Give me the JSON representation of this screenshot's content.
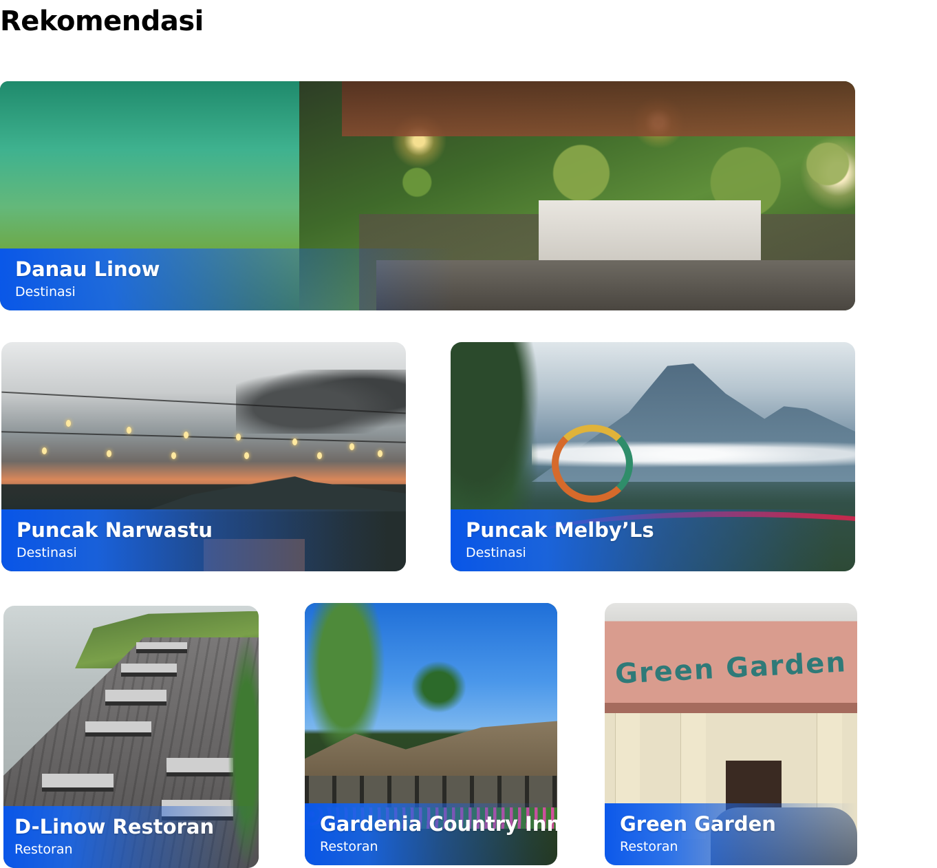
{
  "section": {
    "title": "Rekomendasi"
  },
  "cards": [
    {
      "name": "Danau Linow",
      "category": "Destinasi"
    },
    {
      "name": "Puncak Narwastu",
      "category": "Destinasi"
    },
    {
      "name": "Puncak Melby’Ls",
      "category": "Destinasi"
    },
    {
      "name": "D-Linow Restoran",
      "category": "Restoran"
    },
    {
      "name": "Gardenia Country Inn",
      "category": "Restoran"
    },
    {
      "name": "Green Garden",
      "category": "Restoran"
    }
  ],
  "signage": {
    "green_garden_sign": "Green Garden"
  },
  "colors": {
    "caption_blue": "#0856eb",
    "caption_text": "#ffffff"
  }
}
